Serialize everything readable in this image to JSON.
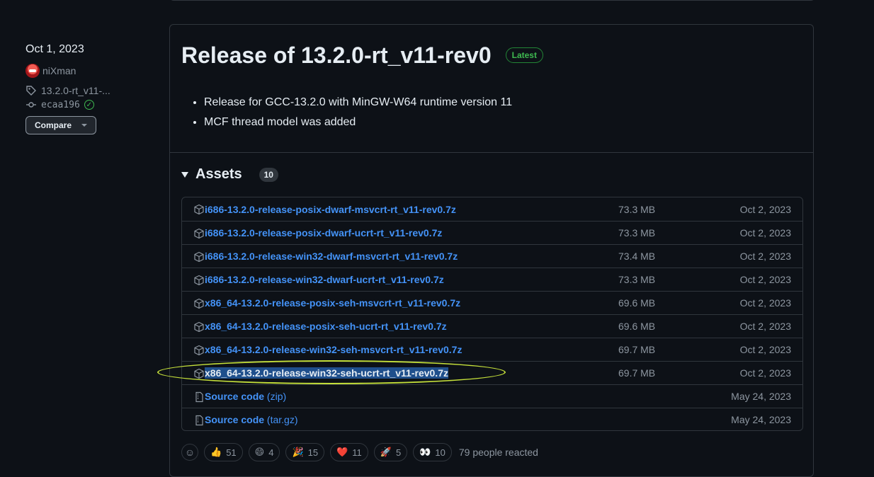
{
  "meta": {
    "date": "Oct 1, 2023",
    "author": "niXman",
    "tag": "13.2.0-rt_v11-...",
    "commit": "ecaa196",
    "compare_label": "Compare"
  },
  "release": {
    "title": "Release of 13.2.0-rt_v11-rev0",
    "badge": "Latest",
    "notes": [
      "Release for GCC-13.2.0 with MinGW-W64 runtime version 11",
      "MCF thread model was added"
    ]
  },
  "assets": {
    "title": "Assets",
    "count": "10",
    "files": [
      {
        "name": "i686-13.2.0-release-posix-dwarf-msvcrt-rt_v11-rev0.7z",
        "size": "73.3 MB",
        "date": "Oct 2, 2023"
      },
      {
        "name": "i686-13.2.0-release-posix-dwarf-ucrt-rt_v11-rev0.7z",
        "size": "73.3 MB",
        "date": "Oct 2, 2023"
      },
      {
        "name": "i686-13.2.0-release-win32-dwarf-msvcrt-rt_v11-rev0.7z",
        "size": "73.4 MB",
        "date": "Oct 2, 2023"
      },
      {
        "name": "i686-13.2.0-release-win32-dwarf-ucrt-rt_v11-rev0.7z",
        "size": "73.3 MB",
        "date": "Oct 2, 2023"
      },
      {
        "name": "x86_64-13.2.0-release-posix-seh-msvcrt-rt_v11-rev0.7z",
        "size": "69.6 MB",
        "date": "Oct 2, 2023"
      },
      {
        "name": "x86_64-13.2.0-release-posix-seh-ucrt-rt_v11-rev0.7z",
        "size": "69.6 MB",
        "date": "Oct 2, 2023"
      },
      {
        "name": "x86_64-13.2.0-release-win32-seh-msvcrt-rt_v11-rev0.7z",
        "size": "69.7 MB",
        "date": "Oct 2, 2023"
      },
      {
        "name": "x86_64-13.2.0-release-win32-seh-ucrt-rt_v11-rev0.7z",
        "size": "69.7 MB",
        "date": "Oct 2, 2023"
      }
    ],
    "source": [
      {
        "name": "Source code",
        "ext": "(zip)",
        "date": "May 24, 2023"
      },
      {
        "name": "Source code",
        "ext": "(tar.gz)",
        "date": "May 24, 2023"
      }
    ]
  },
  "reactions": {
    "items": [
      {
        "emoji": "👍",
        "count": "51"
      },
      {
        "emoji": "😄",
        "count": "4"
      },
      {
        "emoji": "🎉",
        "count": "15"
      },
      {
        "emoji": "❤️",
        "count": "11"
      },
      {
        "emoji": "🚀",
        "count": "5"
      },
      {
        "emoji": "👀",
        "count": "10"
      }
    ],
    "summary": "79 people reacted"
  },
  "colors": {
    "background": "#0d1117",
    "link": "#4493f8",
    "latest_badge": "#3fb950",
    "highlight_ellipse": "#c5e03a",
    "selection": "#1f4f8c"
  }
}
